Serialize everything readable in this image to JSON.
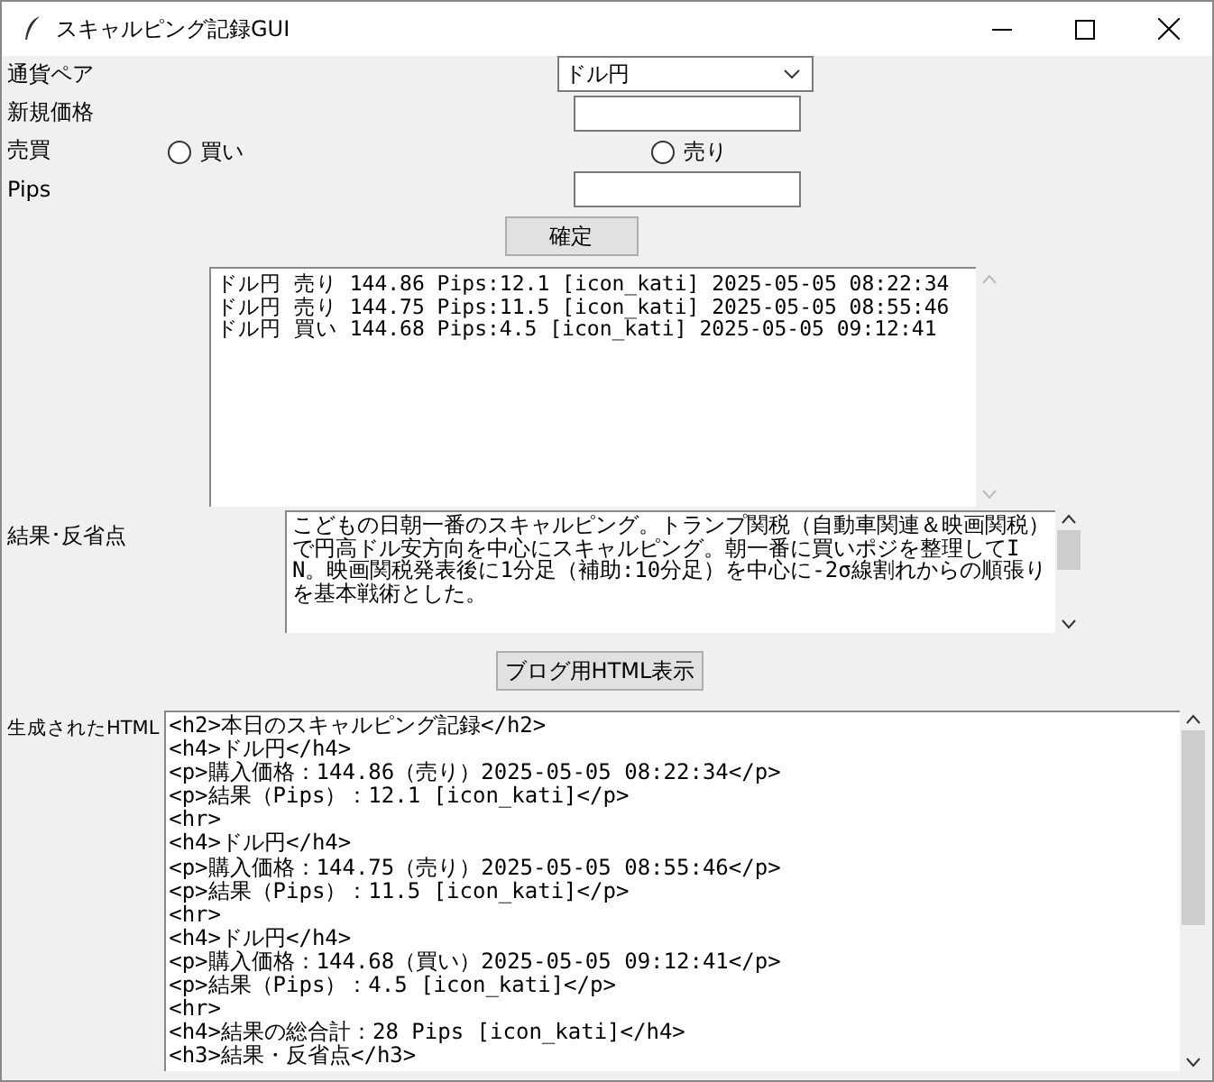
{
  "window": {
    "title": "スキャルピング記録GUI"
  },
  "form": [
    {
      "kind": "combo",
      "label": "通貨ペア",
      "value": "ドル円"
    },
    {
      "kind": "entry",
      "label": "新規価格"
    },
    {
      "kind": "radio",
      "label": "売買",
      "options": [
        {
          "label": "買い",
          "selected": false
        },
        {
          "label": "売り",
          "selected": false
        }
      ]
    },
    {
      "kind": "entry",
      "label": "Pips"
    }
  ],
  "confirm_button": "確定",
  "records": [
    "ドル円 売り 144.86 Pips:12.1 [icon_kati] 2025-05-05 08:22:34",
    "ドル円 売り 144.75 Pips:11.5 [icon_kati] 2025-05-05 08:55:46",
    "ドル円 買い 144.68 Pips:4.5 [icon_kati] 2025-05-05 09:12:41"
  ],
  "notes": {
    "label": "結果･反省点",
    "value": "こどもの日朝一番のスキャルピング。トランプ関税（自動車関連＆映画関税）で円高ドル安方向を中心にスキャルピング。朝一番に買いポジを整理してIN。映画関税発表後に1分足（補助:10分足）を中心に-2σ線割れからの順張りを基本戦術とした。"
  },
  "html_button": "ブログ用HTML表示",
  "html_output": {
    "label": "生成されたHTML",
    "lines": [
      "<h2>本日のスキャルピング記録</h2>",
      "<h4>ドル円</h4>",
      "<p>購入価格：144.86（売り）2025-05-05 08:22:34</p>",
      "<p>結果（Pips）：12.1 [icon_kati]</p>",
      "<hr>",
      "<h4>ドル円</h4>",
      "<p>購入価格：144.75（売り）2025-05-05 08:55:46</p>",
      "<p>結果（Pips）：11.5 [icon_kati]</p>",
      "<hr>",
      "<h4>ドル円</h4>",
      "<p>購入価格：144.68（買い）2025-05-05 09:12:41</p>",
      "<p>結果（Pips）：4.5 [icon_kati]</p>",
      "<hr>",
      "<h4>結果の総合計：28 Pips [icon_kati]</h4>",
      "<h3>結果・反省点</h3>"
    ]
  }
}
